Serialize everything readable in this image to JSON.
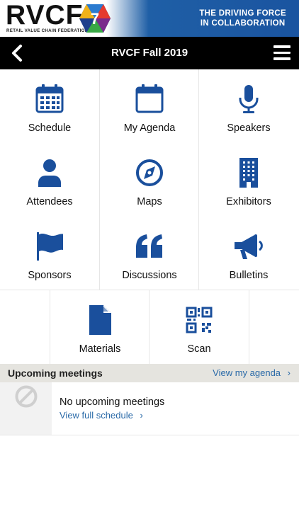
{
  "banner": {
    "logo_text": "RVCF",
    "logo_subtext": "RETAIL VALUE CHAIN FEDERATION",
    "tagline_line1": "THE DRIVING FORCE",
    "tagline_line2": "IN COLLABORATION"
  },
  "header": {
    "title": "RVCF Fall 2019",
    "back_icon": "chevron-left-icon",
    "menu_icon": "hamburger-icon"
  },
  "tiles": [
    {
      "label": "Schedule",
      "icon": "calendar-grid-icon"
    },
    {
      "label": "My Agenda",
      "icon": "calendar-icon"
    },
    {
      "label": "Speakers",
      "icon": "microphone-icon"
    },
    {
      "label": "Attendees",
      "icon": "person-icon"
    },
    {
      "label": "Maps",
      "icon": "compass-icon"
    },
    {
      "label": "Exhibitors",
      "icon": "building-icon"
    },
    {
      "label": "Sponsors",
      "icon": "flag-icon"
    },
    {
      "label": "Discussions",
      "icon": "quote-icon"
    },
    {
      "label": "Bulletins",
      "icon": "megaphone-icon"
    },
    {
      "label": "Materials",
      "icon": "document-icon"
    },
    {
      "label": "Scan",
      "icon": "qr-code-icon"
    }
  ],
  "upcoming": {
    "title": "Upcoming meetings",
    "view_agenda": "View my agenda",
    "empty_message": "No upcoming meetings",
    "view_schedule": "View full schedule"
  },
  "colors": {
    "accent": "#1a4f9c",
    "link": "#2a6aa8",
    "titlebar": "#000000",
    "section_bar": "#e5e4df"
  }
}
